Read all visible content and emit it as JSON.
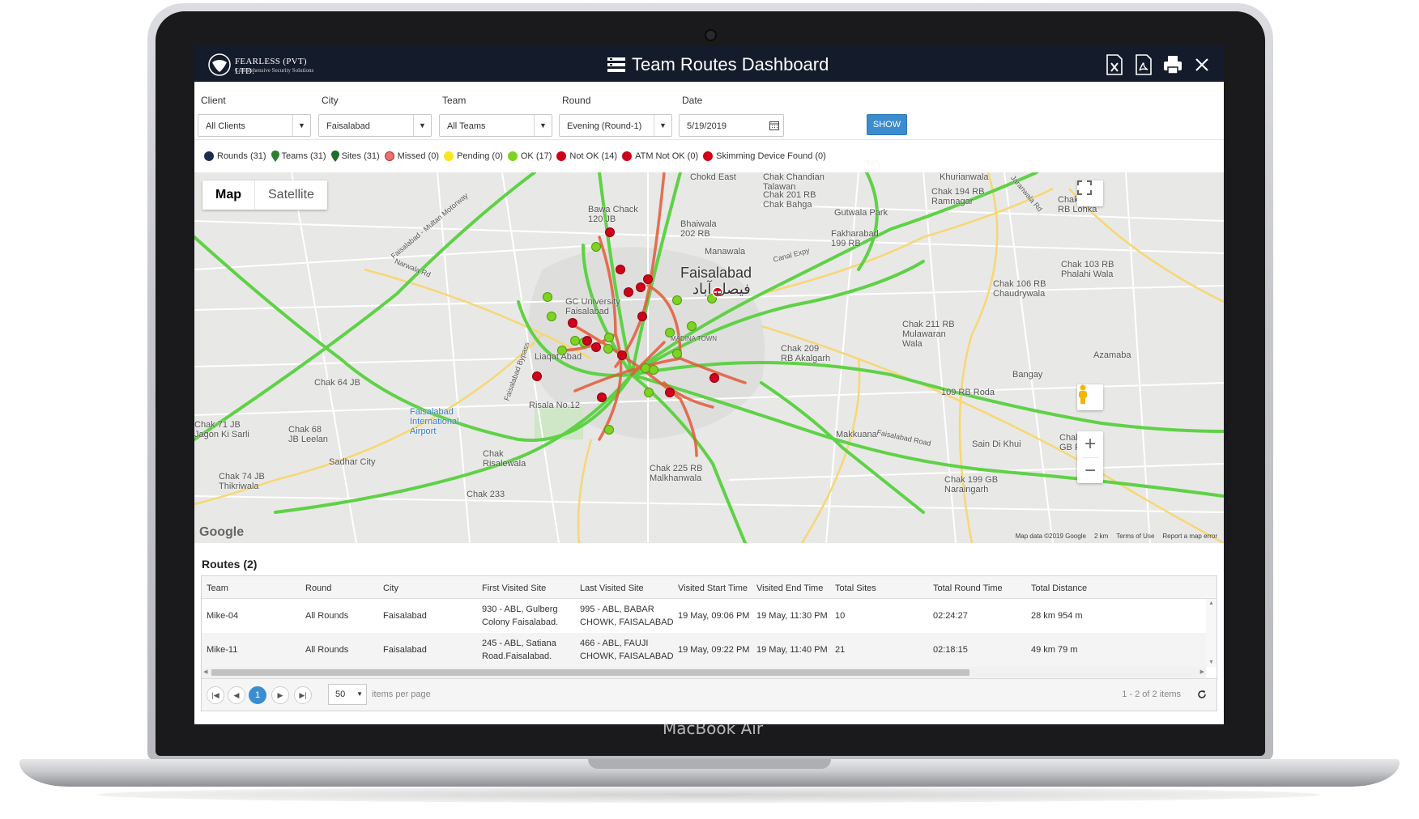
{
  "device": {
    "brand": "MacBook Air"
  },
  "header": {
    "logo_name": "FEARLESS (PVT) LTD.",
    "logo_tagline": "Comprehensive Security Solutions",
    "title": "Team Routes Dashboard",
    "icons": [
      "excel-export-icon",
      "pdf-export-icon",
      "print-icon",
      "close-icon"
    ]
  },
  "filters": {
    "client": {
      "label": "Client",
      "value": "All Clients"
    },
    "city": {
      "label": "City",
      "value": "Faisalabad"
    },
    "team": {
      "label": "Team",
      "value": "All Teams"
    },
    "round": {
      "label": "Round",
      "value": "Evening (Round-1)"
    },
    "date": {
      "label": "Date",
      "value": "5/19/2019"
    },
    "show_label": "SHOW"
  },
  "legend": {
    "rounds": "Rounds (31)",
    "teams": "Teams (31)",
    "sites": "Sites (31)",
    "missed": "Missed (0)",
    "pending": "Pending (0)",
    "ok": "OK (17)",
    "not_ok": "Not OK (14)",
    "atm_not_ok": "ATM Not OK (0)",
    "skimming": "Skimming Device Found (0)",
    "colors": {
      "ok": "#7ed321",
      "not_ok": "#d0021b",
      "pending": "#f8e71c",
      "rounds": "#1f2d4d"
    }
  },
  "map": {
    "type_map": "Map",
    "type_satellite": "Satellite",
    "zoom_in": "+",
    "zoom_out": "−",
    "city_label": "Faisalabad",
    "city_label_urdu": "فیصل آباد",
    "labels": {
      "bawa_chack": "Bawa Chack\n120 JB",
      "bhaiwala": "Bhaiwala\n202 RB",
      "manawala": "Manawala",
      "gc_university": "GC University\nFaisalabad",
      "liaqat_abad": "Liaqat Abad",
      "madina_town": "MADINA TOWN",
      "risala": "Risala No.12",
      "airport": "Faisalabad\nInternational\nAirport",
      "chak_risalewala": "Chak\nRisalewala",
      "chak_225": "Chak 225 RB\nMalkhanwala",
      "chak_209": "Chak 209\nRB Akalgarh",
      "chak_211": "Chak 211 RB\nMulawaran\nWala",
      "chak_106": "Chak 106 RB\nChaudrywala",
      "chak_103": "Chak 103 RB\nPhalahi Wala",
      "chak_194": "Chak 194 RB\nRamnagar",
      "khurianwala": "Khurianwala",
      "gutwala": "Gutwala Park",
      "fakharabad": "Fakharabad\n199 RB",
      "chak_201": "Chak 201 RB\nChak Bahga",
      "chak_64": "Chak 64 JB",
      "chak_68": "Chak 68\nJB Leelan",
      "chak_71": "Chak 71 JB\nJagon Ki Sarli",
      "chak_74": "Chak 74 JB\nThikriwala",
      "sadhar": "Sadhar City",
      "chak_233": "Chak 233",
      "makkuana": "Makkuana",
      "sain_di_khui": "Sain Di Khui",
      "bangay": "Bangay",
      "rb_109": "109 RB Roda",
      "azamabad": "Azamaba",
      "chak_lohka": "Chak 197\nRB Lohka",
      "chak_196": "Chak 196\nGB Phar",
      "naraingarh": "Chak 199 GB\nNaraingarh",
      "chokd": "Chokd East",
      "chandian": "Chak Chandian\nTalawan",
      "narwala_rd": "Narwala Rd",
      "faisalabad_bypass": "Faisalabad Bypass",
      "canal_expy": "Canal Expy",
      "motorway": "Faisalabad - Multan Motorway",
      "jaranwala_rd": "Jaranwala Rd",
      "faisalabad_road": "Faisalabad Road"
    },
    "footer_data": "Map data ©2019 Google",
    "footer_scale": "2 km",
    "footer_terms": "Terms of Use",
    "footer_report": "Report a map error",
    "google": "Google"
  },
  "routes": {
    "title": "Routes (2)",
    "columns": [
      "Team",
      "Round",
      "City",
      "First Visited Site",
      "Last Visited Site",
      "Visited Start Time",
      "Visited End Time",
      "Total Sites",
      "Total Round Time",
      "Total Distance"
    ],
    "rows": [
      {
        "team": "Mike-04",
        "round": "All Rounds",
        "city": "Faisalabad",
        "first_1": "930 - ABL, Gulberg",
        "first_2": "Colony Faisalabad.",
        "last_1": "995 - ABL, BABAR",
        "last_2": "CHOWK, FAISALABAD",
        "start": "19 May, 09:06 PM",
        "end": "19 May, 11:30 PM",
        "sites": "10",
        "round_time": "02:24:27",
        "distance": "28 km 954 m"
      },
      {
        "team": "Mike-11",
        "round": "All Rounds",
        "city": "Faisalabad",
        "first_1": "245 - ABL, Satiana",
        "first_2": "Road.Faisalabad.",
        "last_1": "466 - ABL, FAUJI",
        "last_2": "CHOWK, FAISALABAD",
        "start": "19 May, 09:22 PM",
        "end": "19 May, 11:40 PM",
        "sites": "21",
        "round_time": "02:18:15",
        "distance": "49 km 79 m"
      }
    ],
    "pager": {
      "current_page": "1",
      "page_size": "50",
      "per_page_label": "items per page",
      "summary": "1 - 2 of 2 items"
    }
  }
}
